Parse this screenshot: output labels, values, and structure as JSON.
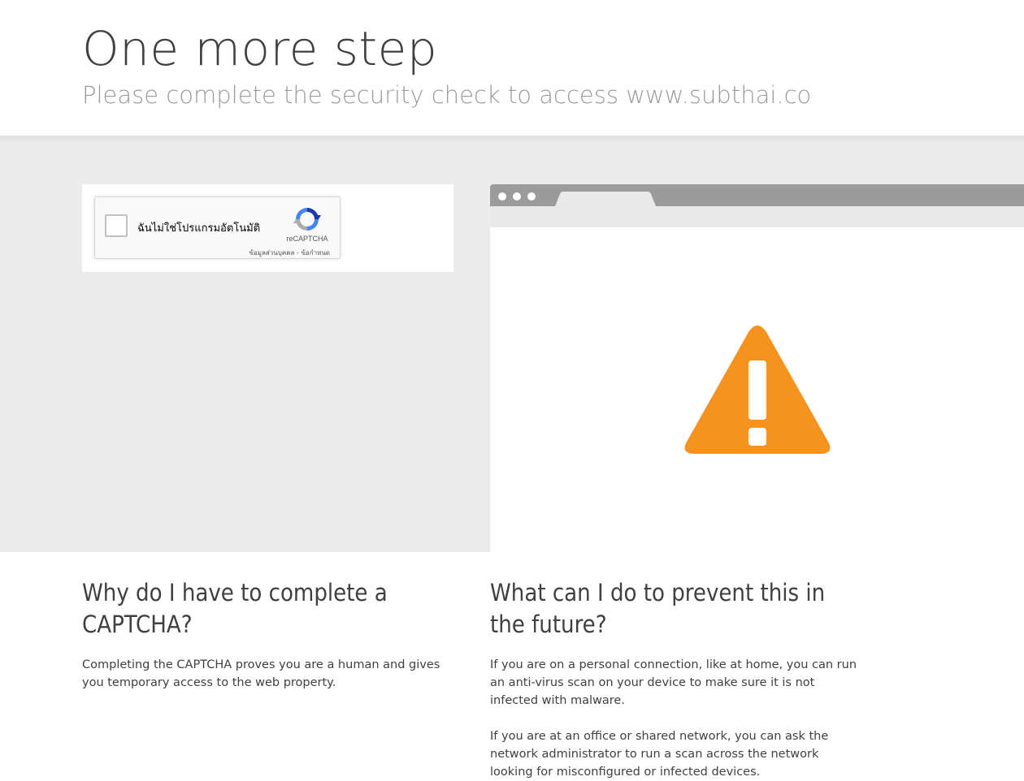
{
  "header": {
    "headline": "One more step",
    "subheadline": "Please complete the security check to access www.subthai.co"
  },
  "recaptcha": {
    "checkbox_label": "ฉันไม่ใช่โปรแกรมอัตโนมัติ",
    "brand": "reCAPTCHA",
    "privacy_link": "ข้อมูลส่วนบุคคล",
    "separator": " - ",
    "terms_link": "ข้อกำหนด",
    "checked": false
  },
  "browser_illustration": {
    "icon": "warning-triangle-icon",
    "icon_color": "#f6921e",
    "bar_color": "#9b9b9b"
  },
  "faq": [
    {
      "question": "Why do I have to complete a CAPTCHA?",
      "answers": [
        "Completing the CAPTCHA proves you are a human and gives you temporary access to the web property."
      ]
    },
    {
      "question": "What can I do to prevent this in the future?",
      "answers": [
        "If you are on a personal connection, like at home, you can run an anti-virus scan on your device to make sure it is not infected with malware.",
        "If you are at an office or shared network, you can ask the network administrator to run a scan across the network looking for misconfigured or infected devices."
      ]
    }
  ]
}
